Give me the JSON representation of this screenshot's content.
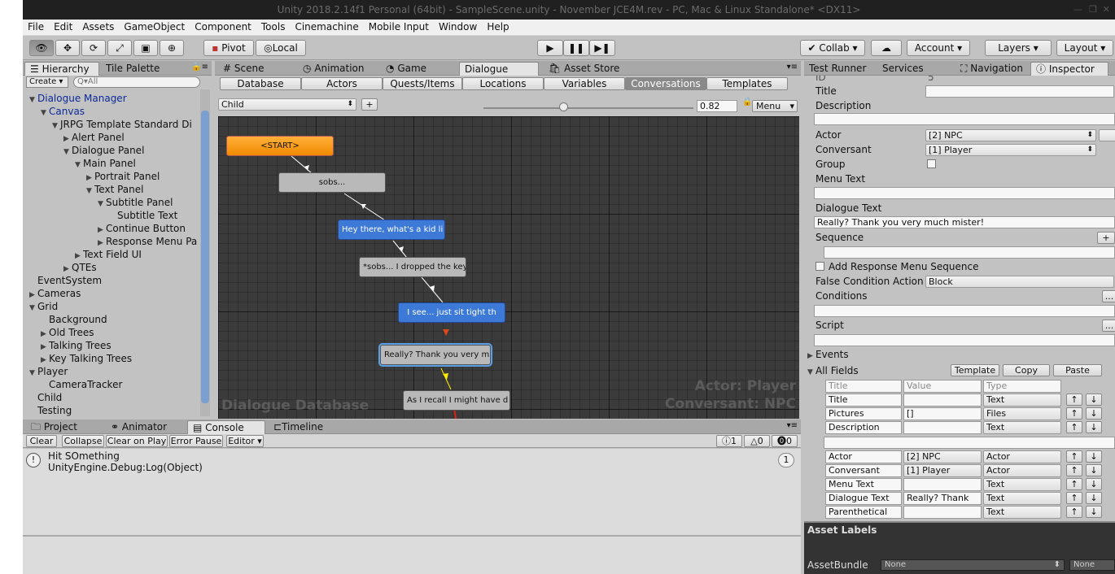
{
  "window": {
    "title": "Unity 2018.2.14f1 Personal (64bit) - SampleScene.unity - November JCE4M.rev - PC, Mac & Linux Standalone* <DX11>"
  },
  "menu": [
    "File",
    "Edit",
    "Assets",
    "GameObject",
    "Component",
    "Tools",
    "Cinemachine",
    "Mobile Input",
    "Window",
    "Help"
  ],
  "toolbar": {
    "pivot": "Pivot",
    "local": "Local",
    "collab": "Collab",
    "account": "Account",
    "layers": "Layers",
    "layout": "Layout"
  },
  "hierarchy": {
    "tabs": [
      "Hierarchy",
      "Tile Palette"
    ],
    "create": "Create",
    "search_placeholder": "Q▾All",
    "items": [
      {
        "label": "Dialogue Manager",
        "indent": 1,
        "open": true,
        "blue": true
      },
      {
        "label": "Canvas",
        "indent": 2,
        "open": true,
        "blue": true
      },
      {
        "label": "JRPG Template Standard Di",
        "indent": 3,
        "open": true
      },
      {
        "label": "Alert Panel",
        "indent": 4,
        "open": false
      },
      {
        "label": "Dialogue Panel",
        "indent": 4,
        "open": true
      },
      {
        "label": "Main Panel",
        "indent": 5,
        "open": true
      },
      {
        "label": "Portrait Panel",
        "indent": 6,
        "open": false
      },
      {
        "label": "Text Panel",
        "indent": 6,
        "open": true
      },
      {
        "label": "Subtitle Panel",
        "indent": 7,
        "open": true
      },
      {
        "label": "Subtitle Text",
        "indent": 8,
        "leaf": true
      },
      {
        "label": "Continue Button",
        "indent": 7,
        "open": false
      },
      {
        "label": "Response Menu Pa",
        "indent": 7,
        "open": false
      },
      {
        "label": "Text Field UI",
        "indent": 5,
        "open": false
      },
      {
        "label": "QTEs",
        "indent": 4,
        "open": false
      },
      {
        "label": "EventSystem",
        "indent": 1,
        "leaf": true
      },
      {
        "label": "Cameras",
        "indent": 1,
        "open": false
      },
      {
        "label": "Grid",
        "indent": 1,
        "open": true
      },
      {
        "label": "Background",
        "indent": 2,
        "leaf": true
      },
      {
        "label": "Old Trees",
        "indent": 2,
        "open": false
      },
      {
        "label": "Talking Trees",
        "indent": 2,
        "open": false
      },
      {
        "label": "Key Talking Trees",
        "indent": 2,
        "open": false
      },
      {
        "label": "Player",
        "indent": 1,
        "open": true
      },
      {
        "label": "CameraTracker",
        "indent": 2,
        "leaf": true
      },
      {
        "label": "Child",
        "indent": 1,
        "leaf": true
      },
      {
        "label": "Testing",
        "indent": 1,
        "leaf": true
      }
    ]
  },
  "center": {
    "tabs": [
      "Scene",
      "Animation",
      "Game",
      "Dialogue",
      "Asset Store"
    ],
    "db_tabs": [
      "Database",
      "Actors",
      "Quests/Items",
      "Locations",
      "Variables",
      "Conversations",
      "Templates"
    ],
    "conversation": "Child",
    "add": "+",
    "zoom": "0.82",
    "zoom_fraction": 0.38,
    "menu": "Menu",
    "watermark_left": "Dialogue Database",
    "actor_label": "Actor: Player",
    "conversant_label": "Conversant: NPC",
    "nodes": [
      {
        "text": "<START>",
        "kind": "start"
      },
      {
        "text": "sobs...",
        "kind": "npc"
      },
      {
        "text": "Hey there, what's a kid li",
        "kind": "player"
      },
      {
        "text": "*sobs... I dropped the key",
        "kind": "npc"
      },
      {
        "text": "I see... just sit tight th",
        "kind": "player"
      },
      {
        "text": "Really? Thank you very muc",
        "kind": "npc",
        "selected": true
      },
      {
        "text": "As I recall I might have d",
        "kind": "npc"
      }
    ]
  },
  "console": {
    "tabs": [
      "Project",
      "Animator",
      "Console",
      "Timeline"
    ],
    "buttons": [
      "Clear",
      "Collapse",
      "Clear on Play",
      "Error Pause",
      "Editor"
    ],
    "counts": {
      "info": "1",
      "warn": "0",
      "error": "0"
    },
    "message_line1": "Hit SOmething",
    "message_line2": "UnityEngine.Debug:Log(Object)",
    "message_count": "1"
  },
  "inspector": {
    "tabs": [
      "Test Runner",
      "Services",
      "Navigation",
      "Inspector"
    ],
    "id_label": "ID",
    "id_value": "5",
    "title_label": "Title",
    "description_label": "Description",
    "actor_label": "Actor",
    "actor_value": "[2] NPC",
    "conversant_label": "Conversant",
    "conversant_value": "[1] Player",
    "group_label": "Group",
    "menu_text_label": "Menu Text",
    "dialogue_text_label": "Dialogue Text",
    "dialogue_text_value": "Really? Thank you very much mister!",
    "sequence_label": "Sequence",
    "add_response_label": "Add Response Menu Sequence",
    "false_condition_label": "False Condition Action",
    "false_condition_value": "Block",
    "conditions_label": "Conditions",
    "script_label": "Script",
    "events_label": "Events",
    "all_fields_label": "All Fields",
    "template_btn": "Template",
    "copy_btn": "Copy",
    "paste_btn": "Paste",
    "ellipsis": "...",
    "plus": "+",
    "grid_headers": [
      "Title",
      "Value",
      "Type"
    ],
    "grid_rows1": [
      {
        "title": "Title",
        "value": "",
        "type": "Text"
      },
      {
        "title": "Pictures",
        "value": "[]",
        "type": "Files"
      },
      {
        "title": "Description",
        "value": "",
        "type": "Text"
      }
    ],
    "grid_rows2": [
      {
        "title": "Actor",
        "value": "[2] NPC",
        "type": "Actor"
      },
      {
        "title": "Conversant",
        "value": "[1] Player",
        "type": "Actor"
      },
      {
        "title": "Menu Text",
        "value": "",
        "type": "Text"
      },
      {
        "title": "Dialogue Text",
        "value": "Really? Thank",
        "type": "Text"
      },
      {
        "title": "Parenthetical",
        "value": "",
        "type": "Text"
      }
    ],
    "asset_labels": "Asset Labels",
    "asset_bundle_label": "AssetBundle",
    "asset_bundle_value": "None",
    "asset_bundle_variant": "None"
  },
  "colors": {
    "accent": "#3d7ad8",
    "start_node": "#f59a12",
    "graph_bg": "#3b3b3b"
  }
}
